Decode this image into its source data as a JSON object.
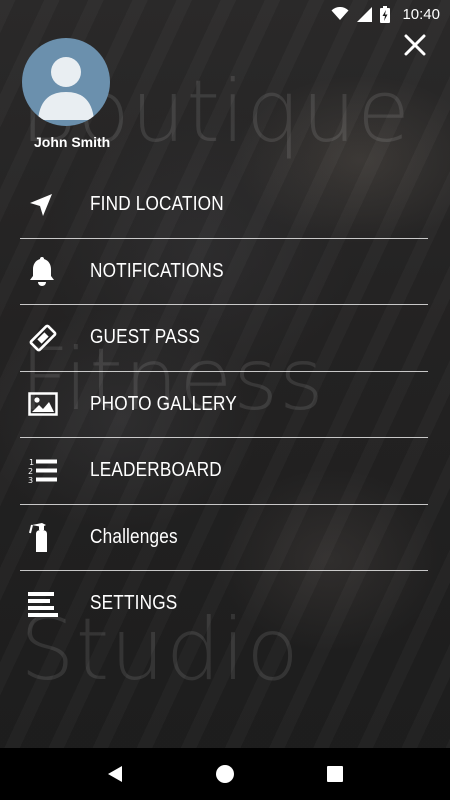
{
  "status_bar": {
    "time": "10:40",
    "icons": [
      "wifi-icon",
      "cell-signal-icon",
      "battery-charging-icon"
    ]
  },
  "background": {
    "watermark_lines": [
      "Boutique",
      "Fitness",
      "Studio"
    ]
  },
  "drawer": {
    "user": {
      "name": "John Smith",
      "avatar_icon": "avatar-placeholder-icon"
    },
    "close_icon": "close-icon",
    "items": [
      {
        "label": "FIND LOCATION",
        "icon": "navigation-arrow-icon"
      },
      {
        "label": "NOTIFICATIONS",
        "icon": "bell-icon"
      },
      {
        "label": "GUEST PASS",
        "icon": "ticket-icon"
      },
      {
        "label": "PHOTO GALLERY",
        "icon": "image-icon"
      },
      {
        "label": "LEADERBOARD",
        "icon": "numbered-list-icon"
      },
      {
        "label": "Challenges",
        "icon": "fire-extinguisher-icon"
      },
      {
        "label": "SETTINGS",
        "icon": "settings-lines-icon"
      }
    ]
  },
  "nav_bar": {
    "buttons": [
      "back-icon",
      "home-icon",
      "recents-icon"
    ]
  }
}
